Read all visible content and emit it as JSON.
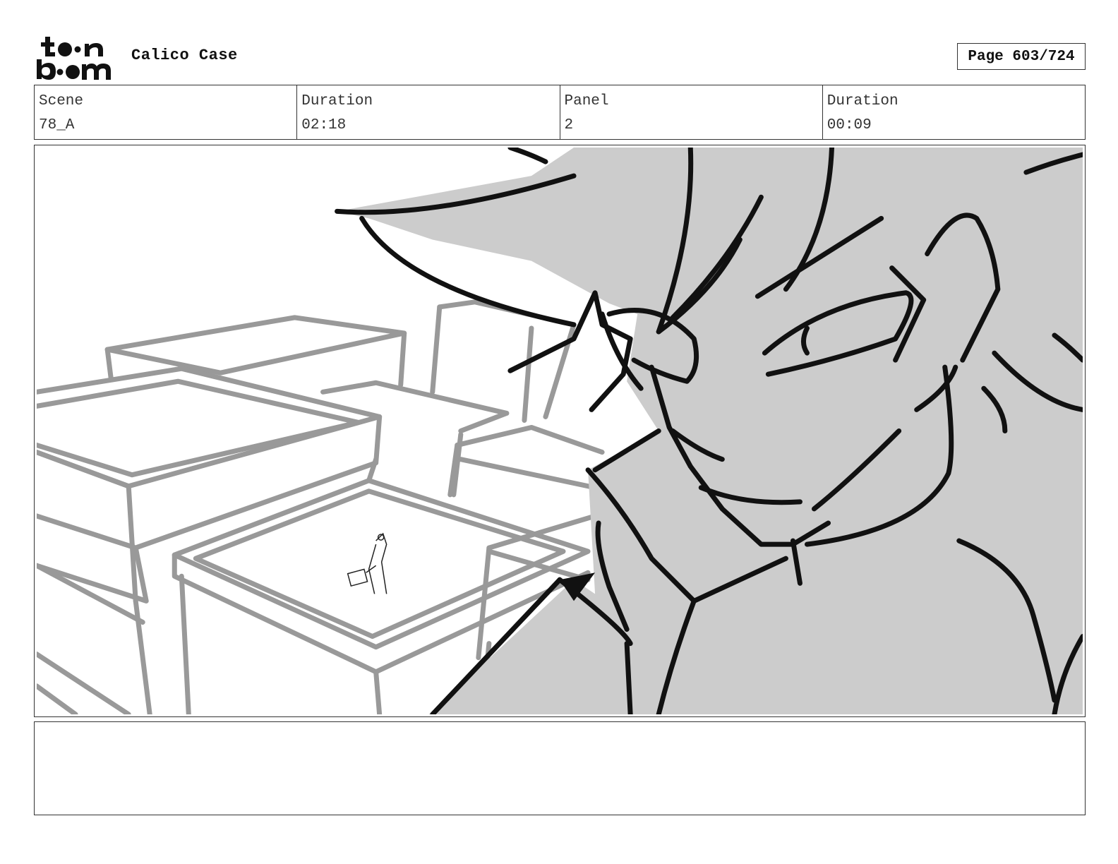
{
  "header": {
    "logo_icon": "toonboom-logo-icon",
    "project_title": "Calico Case",
    "page_label": "Page 603/724"
  },
  "info": {
    "scene_label": "Scene",
    "scene_value": "78_A",
    "scene_duration_label": "Duration",
    "scene_duration_value": "02:18",
    "panel_label": "Panel",
    "panel_value": "2",
    "panel_duration_label": "Duration",
    "panel_duration_value": "00:09"
  },
  "panel_image": {
    "icon": "storyboard-sketch-image",
    "colors": {
      "face_fill": "#cccccc",
      "outline": "#111111",
      "buildings": "#999999"
    }
  },
  "notes": {
    "text": ""
  }
}
